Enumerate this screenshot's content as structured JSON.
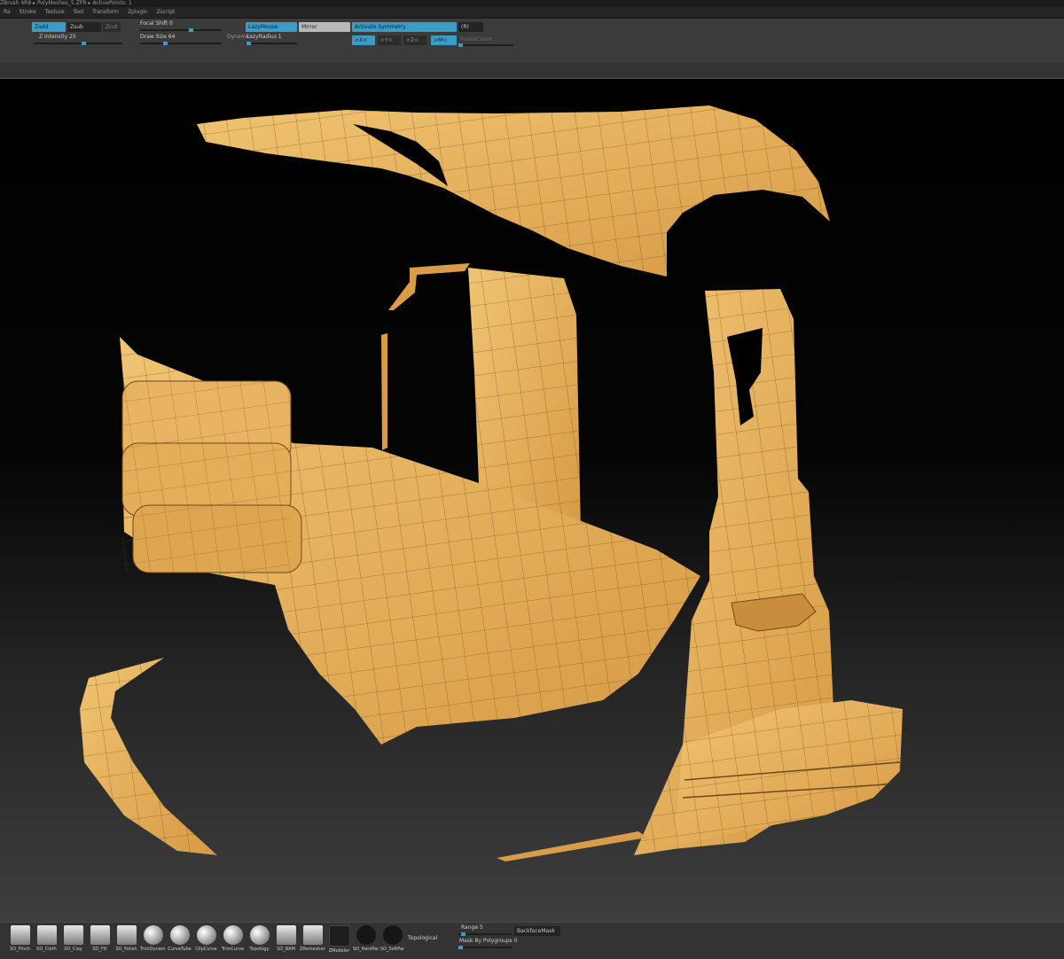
{
  "app": {
    "title_fragment": "ZBrush 4R8 ▸ PolyMeshes_5.ZPR ▸ ActivePoints: 1",
    "accent_color": "#3d9cc4",
    "menu": [
      "Ra",
      "Stroke",
      "Texture",
      "Tool",
      "Transform",
      "Zplugin",
      "Zscript"
    ]
  },
  "top_shelf": {
    "zadd": "Zadd",
    "zsub": "Zsub",
    "zcut": "Zcut",
    "z_intensity": "Z Intensity 25",
    "focal_shift": "Focal Shift 0",
    "draw_size": "Draw Size 64",
    "dynamic": "Dynamic",
    "lazymouse": "LazyMouse",
    "lazyradius": "LazyRadius 1",
    "mirror": "Mirror",
    "activate_symmetry": "Activate Symmetry",
    "r_label": "(R)",
    "sym_x": ">X<",
    "sym_y": ">Y<",
    "sym_z": ">Z<",
    "sym_m": ">M<",
    "radial_count": "RadialCount"
  },
  "canvas": {
    "mesh_color": "#e7ae55",
    "wire_color": "#6b4a1a",
    "background_top": "#000000",
    "background_bottom": "#3e3e3e"
  },
  "bottom_shelf": {
    "brushes": [
      {
        "label": "SO_Pinch",
        "icon": "plane-icon"
      },
      {
        "label": "SO_Cloth",
        "icon": "plane-icon"
      },
      {
        "label": "SO_Clay",
        "icon": "plane-icon"
      },
      {
        "label": "SO_Fill",
        "icon": "plane-icon"
      },
      {
        "label": "SO_Polish",
        "icon": "plane-icon"
      },
      {
        "label": "TrimDynamic",
        "icon": "sphere-icon"
      },
      {
        "label": "CurveTube",
        "icon": "tube-icon"
      },
      {
        "label": "ClipCurve",
        "icon": "clip-icon"
      },
      {
        "label": "TrimCurve",
        "icon": "trim-icon"
      },
      {
        "label": "Topology",
        "icon": "topology-icon"
      },
      {
        "label": "SO_BAM",
        "icon": "bam-icon"
      },
      {
        "label": "ZRemesherG",
        "icon": "cube-icon"
      },
      {
        "label": "ZModeler",
        "icon": "zmodeler-icon"
      },
      {
        "label": "SO_HardPar",
        "icon": "pen-icon"
      },
      {
        "label": "SO_SoftPar",
        "icon": "pen-icon"
      }
    ],
    "topological": "Topological",
    "range": "Range 5",
    "backface_mask": "BackfaceMask",
    "mask_by_polygroups": "Mask By Polygroups 0"
  }
}
